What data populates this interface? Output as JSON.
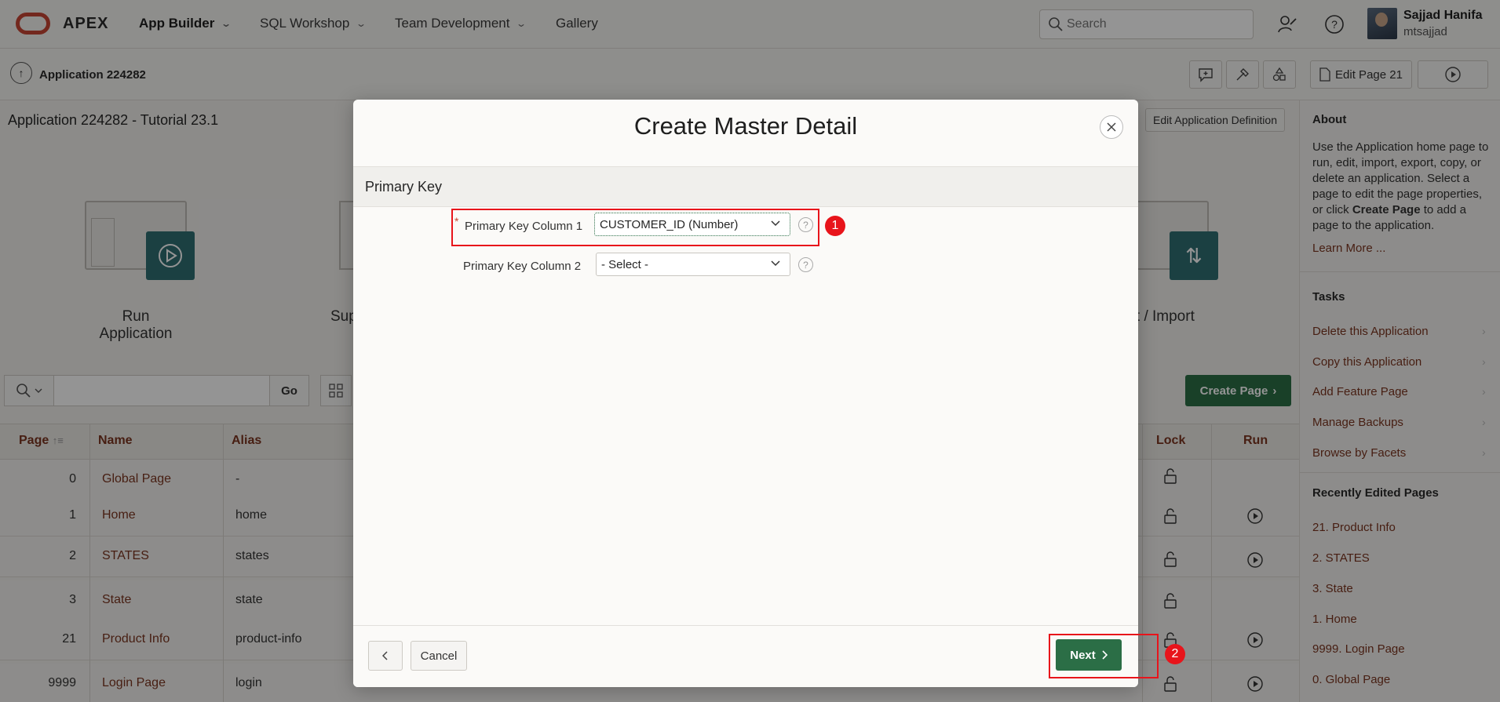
{
  "header": {
    "brand": "APEX",
    "nav": [
      "App Builder",
      "SQL Workshop",
      "Team Development",
      "Gallery"
    ],
    "search_placeholder": "Search",
    "user_name": "Sajjad Hanifa",
    "user_id": "mtsajjad"
  },
  "subbar": {
    "breadcrumb": "Application 224282",
    "edit_page": "Edit Page 21"
  },
  "app": {
    "title": "Application 224282 - Tutorial 23.1",
    "edit_def": "Edit Application Definition",
    "cards": [
      "Run Application",
      "Sup",
      "ort / Import"
    ]
  },
  "toolbar": {
    "go": "Go",
    "create_page": "Create Page"
  },
  "grid": {
    "columns": [
      "Page",
      "Name",
      "Alias",
      "Lock",
      "Run"
    ],
    "rows": [
      {
        "page": "0",
        "name": "Global Page",
        "alias": "-"
      },
      {
        "page": "1",
        "name": "Home",
        "alias": "home"
      },
      {
        "page": "2",
        "name": "STATES",
        "alias": "states"
      },
      {
        "page": "3",
        "name": "State",
        "alias": "state"
      },
      {
        "page": "21",
        "name": "Product Info",
        "alias": "product-info"
      },
      {
        "page": "9999",
        "name": "Login Page",
        "alias": "login"
      }
    ]
  },
  "sidebar": {
    "about_title": "About",
    "about_text_1": "Use the Application home page to run, edit, import, export, copy, or delete an application. Select a page to edit the page properties, or click ",
    "about_text_bold": "Create Page",
    "about_text_2": " to add a page to the application.",
    "learn_more": "Learn More ...",
    "tasks_title": "Tasks",
    "tasks": [
      "Delete this Application",
      "Copy this Application",
      "Add Feature Page",
      "Manage Backups",
      "Browse by Facets"
    ],
    "recent_title": "Recently Edited Pages",
    "recent": [
      "21. Product Info",
      "2. STATES",
      "3. State",
      "1. Home",
      "9999. Login Page",
      "0. Global Page"
    ]
  },
  "modal": {
    "title": "Create Master Detail",
    "region": "Primary Key",
    "pk1_label": "Primary Key Column 1",
    "pk1_value": "CUSTOMER_ID (Number)",
    "pk2_label": "Primary Key Column 2",
    "pk2_value": "- Select -",
    "cancel": "Cancel",
    "next": "Next"
  },
  "annotations": [
    "1",
    "2"
  ],
  "colors": {
    "accent_green": "#2b6e46",
    "brand_red": "#c74634",
    "highlight": "#e8141b",
    "teal_tile": "#2f6e73"
  }
}
